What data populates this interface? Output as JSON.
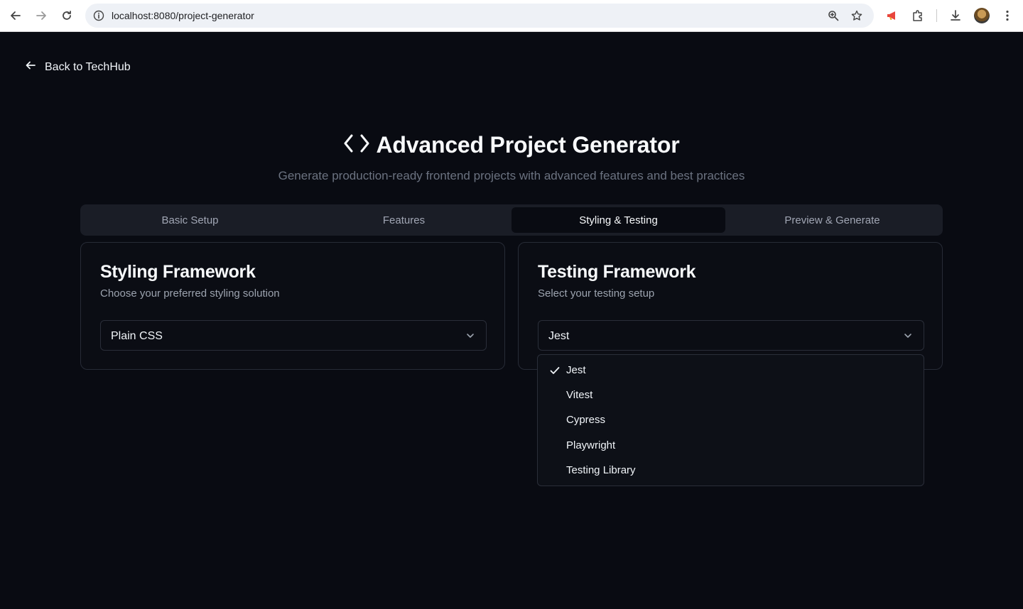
{
  "browser": {
    "url": "localhost:8080/project-generator"
  },
  "nav": {
    "back_label": "Back to TechHub"
  },
  "header": {
    "title": "Advanced Project Generator",
    "subtitle": "Generate production-ready frontend projects with advanced features and best practices"
  },
  "tabs": [
    {
      "label": "Basic Setup",
      "active": false
    },
    {
      "label": "Features",
      "active": false
    },
    {
      "label": "Styling & Testing",
      "active": true
    },
    {
      "label": "Preview & Generate",
      "active": false
    }
  ],
  "styling": {
    "title": "Styling Framework",
    "description": "Choose your preferred styling solution",
    "selected": "Plain CSS"
  },
  "testing": {
    "title": "Testing Framework",
    "description": "Select your testing setup",
    "selected": "Jest",
    "options": [
      "Jest",
      "Vitest",
      "Cypress",
      "Playwright",
      "Testing Library"
    ]
  },
  "colors": {
    "background": "#090b12",
    "tab_track": "#1a1d26",
    "border": "#272b36",
    "text": "#f8fafc",
    "muted": "#9ca3af"
  }
}
